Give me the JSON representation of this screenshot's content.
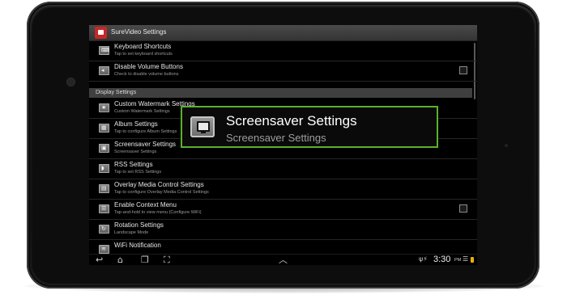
{
  "window": {
    "app_title": "SureVideo Settings"
  },
  "list": {
    "items": [
      {
        "title": "Keyboard Shortcuts",
        "subtitle": "Tap to set keyboard shortcuts",
        "icon": "keyboard-icon",
        "checkbox": false
      },
      {
        "title": "Disable Volume Buttons",
        "subtitle": "Check to disable volume buttons",
        "icon": "volume-icon",
        "checkbox": true,
        "checked": false
      }
    ],
    "section_header": "Display Settings",
    "display_items": [
      {
        "title": "Custom Watermark Settings",
        "subtitle": "Custom Watermark Settings",
        "icon": "star-icon",
        "checkbox": false
      },
      {
        "title": "Album Settings",
        "subtitle": "Tap to configure Album Settings",
        "icon": "album-icon",
        "checkbox": false
      },
      {
        "title": "Screensaver Settings",
        "subtitle": "Screensaver Settings",
        "icon": "screensaver-icon",
        "checkbox": false
      },
      {
        "title": "RSS Settings",
        "subtitle": "Tap to set RSS Settings",
        "icon": "rss-icon",
        "checkbox": false
      },
      {
        "title": "Overlay Media Control Settings",
        "subtitle": "Tap to configure Overlay Media Control Settings",
        "icon": "overlay-icon",
        "checkbox": false
      },
      {
        "title": "Enable Context Menu",
        "subtitle": "Tap-and-hold to view menu (Configure WiFi)",
        "icon": "context-menu-icon",
        "checkbox": true,
        "checked": false
      },
      {
        "title": "Rotation Settings",
        "subtitle": "Landscape Mode",
        "icon": "rotation-icon",
        "checkbox": false
      },
      {
        "title": "WiFi Notification",
        "subtitle": "",
        "icon": "wifi-notification-icon",
        "checkbox": false
      }
    ]
  },
  "highlight": {
    "title": "Screensaver Settings",
    "subtitle": "Screensaver Settings"
  },
  "status_bar": {
    "time": "3:30",
    "ampm": "PM"
  },
  "colors": {
    "highlight_border": "#5ab22c",
    "section_bg": "#3f3f3f",
    "battery": "#e8b200"
  }
}
